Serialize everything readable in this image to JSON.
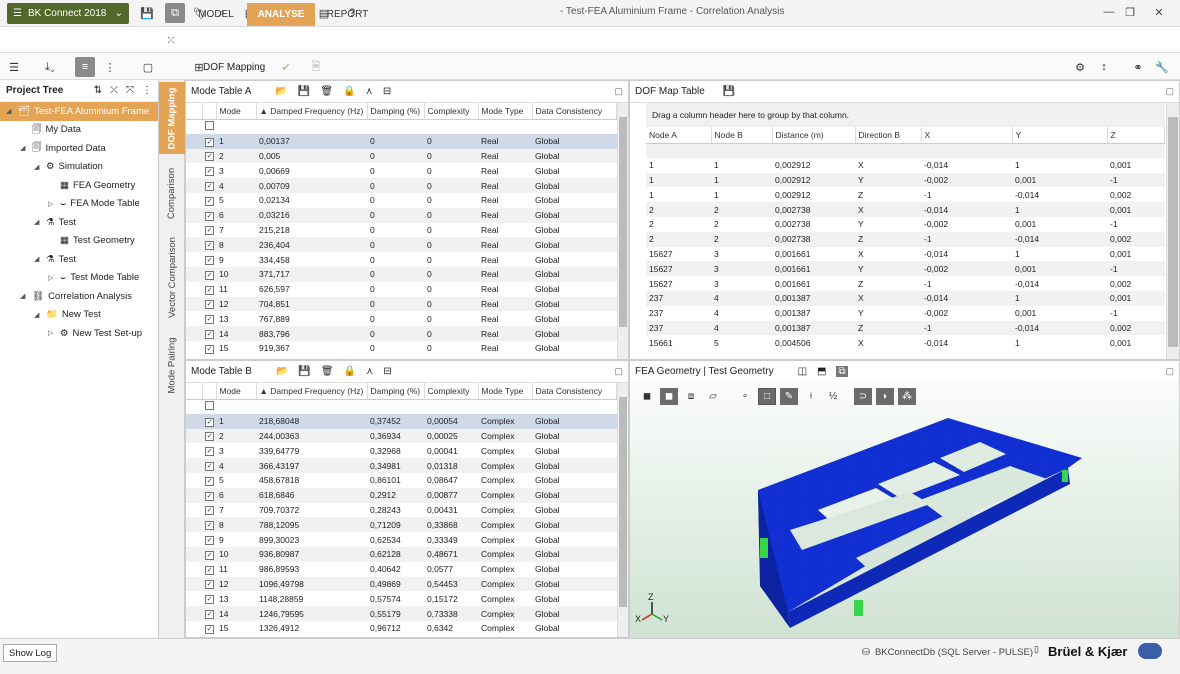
{
  "app": {
    "menu_label": "BK Connect 2018",
    "window_title": "- Test-FEA Aluminium Frame - Correlation Analysis"
  },
  "main_tabs": [
    {
      "label": "MODEL"
    },
    {
      "label": "ANALYSE"
    },
    {
      "label": "REPORT"
    }
  ],
  "toolbar2": {
    "dof_mapping_label": "DOF Mapping"
  },
  "tree": {
    "title": "Project Tree",
    "items": [
      {
        "label": "Test-FEA Aluminium Frame",
        "level": 0,
        "icon": "project-icon",
        "expanded": true,
        "selected": true
      },
      {
        "label": "My Data",
        "level": 1,
        "icon": "data-icon"
      },
      {
        "label": "Imported Data",
        "level": 1,
        "icon": "data-icon",
        "expanded": true
      },
      {
        "label": "Simulation",
        "level": 2,
        "icon": "simulation-icon",
        "expanded": true
      },
      {
        "label": "FEA Geometry",
        "level": 3,
        "icon": "geometry-icon"
      },
      {
        "label": "FEA Mode Table",
        "level": 3,
        "icon": "mode-table-icon",
        "collapsed": true
      },
      {
        "label": "Test",
        "level": 2,
        "icon": "test-icon",
        "expanded": true
      },
      {
        "label": "Test Geometry",
        "level": 3,
        "icon": "geometry-icon"
      },
      {
        "label": "Test",
        "level": 2,
        "icon": "test-icon",
        "expanded": true
      },
      {
        "label": "Test Mode Table",
        "level": 3,
        "icon": "mode-table-icon",
        "collapsed": true
      },
      {
        "label": "Correlation Analysis",
        "level": 1,
        "icon": "correlation-icon",
        "expanded": true
      },
      {
        "label": "New Test",
        "level": 2,
        "icon": "folder-icon",
        "expanded": true
      },
      {
        "label": "New Test Set-up",
        "level": 3,
        "icon": "setup-icon",
        "collapsed": true
      }
    ]
  },
  "vertical_tabs": [
    {
      "label": "DOF Mapping"
    },
    {
      "label": "Comparison"
    },
    {
      "label": "Vector Comparison"
    },
    {
      "label": "Mode Pairing"
    }
  ],
  "mode_table_a": {
    "title": "Mode Table A",
    "columns": [
      "Mode",
      "Damped Frequency (Hz)",
      "Damping (%)",
      "Complexity",
      "Mode Type",
      "Data Consistency"
    ],
    "rows": [
      [
        "1",
        "0,00137",
        "0",
        "0",
        "Real",
        "Global"
      ],
      [
        "2",
        "0,005",
        "0",
        "0",
        "Real",
        "Global"
      ],
      [
        "3",
        "0,00669",
        "0",
        "0",
        "Real",
        "Global"
      ],
      [
        "4",
        "0,00709",
        "0",
        "0",
        "Real",
        "Global"
      ],
      [
        "5",
        "0,02134",
        "0",
        "0",
        "Real",
        "Global"
      ],
      [
        "6",
        "0,03216",
        "0",
        "0",
        "Real",
        "Global"
      ],
      [
        "7",
        "215,218",
        "0",
        "0",
        "Real",
        "Global"
      ],
      [
        "8",
        "236,404",
        "0",
        "0",
        "Real",
        "Global"
      ],
      [
        "9",
        "334,458",
        "0",
        "0",
        "Real",
        "Global"
      ],
      [
        "10",
        "371,717",
        "0",
        "0",
        "Real",
        "Global"
      ],
      [
        "11",
        "626,597",
        "0",
        "0",
        "Real",
        "Global"
      ],
      [
        "12",
        "704,851",
        "0",
        "0",
        "Real",
        "Global"
      ],
      [
        "13",
        "767,889",
        "0",
        "0",
        "Real",
        "Global"
      ],
      [
        "14",
        "883,796",
        "0",
        "0",
        "Real",
        "Global"
      ],
      [
        "15",
        "919,367",
        "0",
        "0",
        "Real",
        "Global"
      ]
    ]
  },
  "mode_table_b": {
    "title": "Mode Table B",
    "columns": [
      "Mode",
      "Damped Frequency (Hz)",
      "Damping (%)",
      "Complexity",
      "Mode Type",
      "Data Consistency"
    ],
    "rows": [
      [
        "1",
        "218,68048",
        "0,37452",
        "0,00054",
        "Complex",
        "Global"
      ],
      [
        "2",
        "244,00363",
        "0,36934",
        "0,00025",
        "Complex",
        "Global"
      ],
      [
        "3",
        "339,64779",
        "0,32968",
        "0,00041",
        "Complex",
        "Global"
      ],
      [
        "4",
        "366,43197",
        "0,34981",
        "0,01318",
        "Complex",
        "Global"
      ],
      [
        "5",
        "458,67818",
        "0,86101",
        "0,08647",
        "Complex",
        "Global"
      ],
      [
        "6",
        "618,6846",
        "0,2912",
        "0,00877",
        "Complex",
        "Global"
      ],
      [
        "7",
        "709,70372",
        "0,28243",
        "0,00431",
        "Complex",
        "Global"
      ],
      [
        "8",
        "788,12095",
        "0,71209",
        "0,33868",
        "Complex",
        "Global"
      ],
      [
        "9",
        "899,30023",
        "0,62534",
        "0,33349",
        "Complex",
        "Global"
      ],
      [
        "10",
        "936,80987",
        "0,62128",
        "0,48671",
        "Complex",
        "Global"
      ],
      [
        "11",
        "986,89593",
        "0,40642",
        "0,0577",
        "Complex",
        "Global"
      ],
      [
        "12",
        "1096,49798",
        "0,49869",
        "0,54453",
        "Complex",
        "Global"
      ],
      [
        "13",
        "1148,28859",
        "0,57574",
        "0,15172",
        "Complex",
        "Global"
      ],
      [
        "14",
        "1246,79595",
        "0,55179",
        "0,73338",
        "Complex",
        "Global"
      ],
      [
        "15",
        "1326,4912",
        "0,96712",
        "0,6342",
        "Complex",
        "Global"
      ]
    ]
  },
  "dof_map_table": {
    "title": "DOF Map Table",
    "group_hint": "Drag a column header here to group by that column.",
    "columns": [
      "Node A",
      "Node B",
      "Distance (m)",
      "Direction B",
      "X",
      "Y",
      "Z"
    ],
    "rows": [
      [
        "1",
        "1",
        "0,002912",
        "X",
        "-0,014",
        "1",
        "0,001"
      ],
      [
        "1",
        "1",
        "0,002912",
        "Y",
        "-0,002",
        "0,001",
        "-1"
      ],
      [
        "1",
        "1",
        "0,002912",
        "Z",
        "-1",
        "-0,014",
        "0,002"
      ],
      [
        "2",
        "2",
        "0,002738",
        "X",
        "-0,014",
        "1",
        "0,001"
      ],
      [
        "2",
        "2",
        "0,002738",
        "Y",
        "-0,002",
        "0,001",
        "-1"
      ],
      [
        "2",
        "2",
        "0,002738",
        "Z",
        "-1",
        "-0,014",
        "0,002"
      ],
      [
        "15627",
        "3",
        "0,001661",
        "X",
        "-0,014",
        "1",
        "0,001"
      ],
      [
        "15627",
        "3",
        "0,001661",
        "Y",
        "-0,002",
        "0,001",
        "-1"
      ],
      [
        "15627",
        "3",
        "0,001661",
        "Z",
        "-1",
        "-0,014",
        "0,002"
      ],
      [
        "237",
        "4",
        "0,001387",
        "X",
        "-0,014",
        "1",
        "0,001"
      ],
      [
        "237",
        "4",
        "0,001387",
        "Y",
        "-0,002",
        "0,001",
        "-1"
      ],
      [
        "237",
        "4",
        "0,001387",
        "Z",
        "-1",
        "-0,014",
        "0,002"
      ],
      [
        "15661",
        "5",
        "0,004506",
        "X",
        "-0,014",
        "1",
        "0,001"
      ]
    ]
  },
  "geometry_view": {
    "title": "FEA Geometry | Test Geometry",
    "mesh_color": "#1433e0",
    "edge_color": "#37d64a",
    "axes": {
      "x": "X",
      "y": "Y",
      "z": "Z"
    }
  },
  "status": {
    "show_log_label": "Show Log",
    "db_label": "BKConnectDb (SQL Server - PULSE)",
    "brand": "Brüel & Kjær"
  },
  "colors": {
    "accent": "#e3a455",
    "app_button": "#52682a",
    "selected_row": "#cfd9e8"
  }
}
